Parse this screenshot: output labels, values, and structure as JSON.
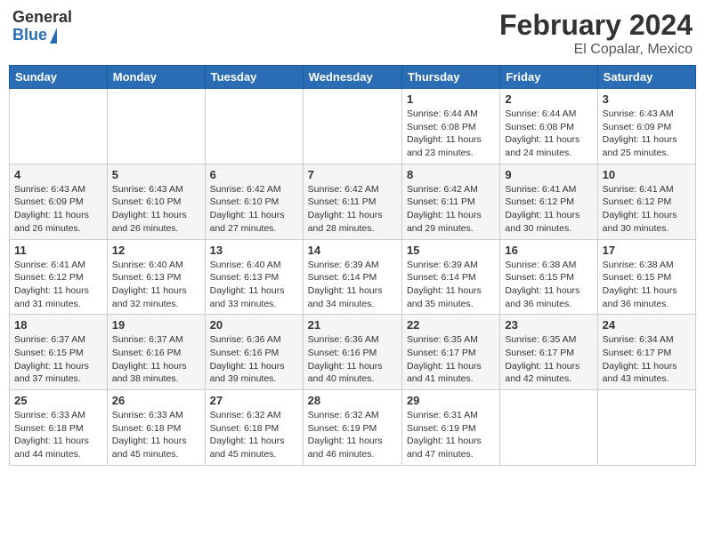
{
  "header": {
    "logo_general": "General",
    "logo_blue": "Blue",
    "title": "February 2024",
    "location": "El Copalar, Mexico"
  },
  "weekdays": [
    "Sunday",
    "Monday",
    "Tuesday",
    "Wednesday",
    "Thursday",
    "Friday",
    "Saturday"
  ],
  "weeks": [
    [
      {
        "day": "",
        "info": ""
      },
      {
        "day": "",
        "info": ""
      },
      {
        "day": "",
        "info": ""
      },
      {
        "day": "",
        "info": ""
      },
      {
        "day": "1",
        "info": "Sunrise: 6:44 AM\nSunset: 6:08 PM\nDaylight: 11 hours\nand 23 minutes."
      },
      {
        "day": "2",
        "info": "Sunrise: 6:44 AM\nSunset: 6:08 PM\nDaylight: 11 hours\nand 24 minutes."
      },
      {
        "day": "3",
        "info": "Sunrise: 6:43 AM\nSunset: 6:09 PM\nDaylight: 11 hours\nand 25 minutes."
      }
    ],
    [
      {
        "day": "4",
        "info": "Sunrise: 6:43 AM\nSunset: 6:09 PM\nDaylight: 11 hours\nand 26 minutes."
      },
      {
        "day": "5",
        "info": "Sunrise: 6:43 AM\nSunset: 6:10 PM\nDaylight: 11 hours\nand 26 minutes."
      },
      {
        "day": "6",
        "info": "Sunrise: 6:42 AM\nSunset: 6:10 PM\nDaylight: 11 hours\nand 27 minutes."
      },
      {
        "day": "7",
        "info": "Sunrise: 6:42 AM\nSunset: 6:11 PM\nDaylight: 11 hours\nand 28 minutes."
      },
      {
        "day": "8",
        "info": "Sunrise: 6:42 AM\nSunset: 6:11 PM\nDaylight: 11 hours\nand 29 minutes."
      },
      {
        "day": "9",
        "info": "Sunrise: 6:41 AM\nSunset: 6:12 PM\nDaylight: 11 hours\nand 30 minutes."
      },
      {
        "day": "10",
        "info": "Sunrise: 6:41 AM\nSunset: 6:12 PM\nDaylight: 11 hours\nand 30 minutes."
      }
    ],
    [
      {
        "day": "11",
        "info": "Sunrise: 6:41 AM\nSunset: 6:12 PM\nDaylight: 11 hours\nand 31 minutes."
      },
      {
        "day": "12",
        "info": "Sunrise: 6:40 AM\nSunset: 6:13 PM\nDaylight: 11 hours\nand 32 minutes."
      },
      {
        "day": "13",
        "info": "Sunrise: 6:40 AM\nSunset: 6:13 PM\nDaylight: 11 hours\nand 33 minutes."
      },
      {
        "day": "14",
        "info": "Sunrise: 6:39 AM\nSunset: 6:14 PM\nDaylight: 11 hours\nand 34 minutes."
      },
      {
        "day": "15",
        "info": "Sunrise: 6:39 AM\nSunset: 6:14 PM\nDaylight: 11 hours\nand 35 minutes."
      },
      {
        "day": "16",
        "info": "Sunrise: 6:38 AM\nSunset: 6:15 PM\nDaylight: 11 hours\nand 36 minutes."
      },
      {
        "day": "17",
        "info": "Sunrise: 6:38 AM\nSunset: 6:15 PM\nDaylight: 11 hours\nand 36 minutes."
      }
    ],
    [
      {
        "day": "18",
        "info": "Sunrise: 6:37 AM\nSunset: 6:15 PM\nDaylight: 11 hours\nand 37 minutes."
      },
      {
        "day": "19",
        "info": "Sunrise: 6:37 AM\nSunset: 6:16 PM\nDaylight: 11 hours\nand 38 minutes."
      },
      {
        "day": "20",
        "info": "Sunrise: 6:36 AM\nSunset: 6:16 PM\nDaylight: 11 hours\nand 39 minutes."
      },
      {
        "day": "21",
        "info": "Sunrise: 6:36 AM\nSunset: 6:16 PM\nDaylight: 11 hours\nand 40 minutes."
      },
      {
        "day": "22",
        "info": "Sunrise: 6:35 AM\nSunset: 6:17 PM\nDaylight: 11 hours\nand 41 minutes."
      },
      {
        "day": "23",
        "info": "Sunrise: 6:35 AM\nSunset: 6:17 PM\nDaylight: 11 hours\nand 42 minutes."
      },
      {
        "day": "24",
        "info": "Sunrise: 6:34 AM\nSunset: 6:17 PM\nDaylight: 11 hours\nand 43 minutes."
      }
    ],
    [
      {
        "day": "25",
        "info": "Sunrise: 6:33 AM\nSunset: 6:18 PM\nDaylight: 11 hours\nand 44 minutes."
      },
      {
        "day": "26",
        "info": "Sunrise: 6:33 AM\nSunset: 6:18 PM\nDaylight: 11 hours\nand 45 minutes."
      },
      {
        "day": "27",
        "info": "Sunrise: 6:32 AM\nSunset: 6:18 PM\nDaylight: 11 hours\nand 45 minutes."
      },
      {
        "day": "28",
        "info": "Sunrise: 6:32 AM\nSunset: 6:19 PM\nDaylight: 11 hours\nand 46 minutes."
      },
      {
        "day": "29",
        "info": "Sunrise: 6:31 AM\nSunset: 6:19 PM\nDaylight: 11 hours\nand 47 minutes."
      },
      {
        "day": "",
        "info": ""
      },
      {
        "day": "",
        "info": ""
      }
    ]
  ]
}
